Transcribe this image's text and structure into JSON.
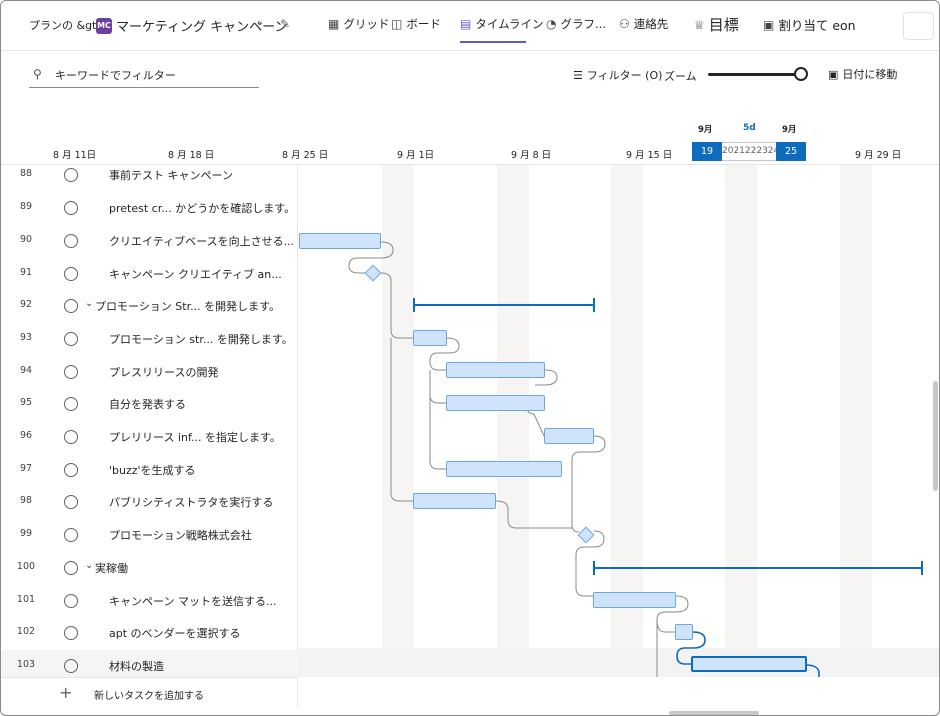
{
  "header": {
    "breadcrumb": "プランの &gt;",
    "plan_badge": "MC",
    "plan_name": "マーケティング キャンペーン",
    "tabs": [
      {
        "label": "グリッド",
        "icon": "grid-icon"
      },
      {
        "label": "ボード",
        "icon": "board-icon"
      },
      {
        "label": "タイムライン",
        "icon": "timeline-icon",
        "active": true
      },
      {
        "label": "グラフ...",
        "icon": "chart-icon"
      },
      {
        "label": "連絡先",
        "icon": "people-icon"
      },
      {
        "label": "目標",
        "icon": "trophy-icon"
      },
      {
        "label": "割り当て eon",
        "icon": "assign-icon"
      }
    ]
  },
  "toolbar": {
    "search_value": "キーワードでフィルター",
    "filter_label": "フィルター (O)",
    "zoom_label": "ズーム",
    "goto_label": "日付に移動"
  },
  "timeline": {
    "dates": [
      "8 月 11日",
      "8 月 18 日",
      "8 月 25 日",
      "9 月 1日",
      "9 月 8 日",
      "9 月 15 日",
      "9 月 29 日"
    ],
    "selection": {
      "month_start": "9月",
      "month_end": "9月",
      "duration": "5d",
      "start_day": "19",
      "middle": "2021222324",
      "end_day": "25"
    }
  },
  "tasks": [
    {
      "num": "88",
      "name": "事前テスト キャンペーン"
    },
    {
      "num": "89",
      "name": "pretest cr... かどうかを確認します。"
    },
    {
      "num": "90",
      "name": "クリエイティブベースを向上させる..."
    },
    {
      "num": "91",
      "name": "キャンペーン クリエイティブ an..."
    },
    {
      "num": "92",
      "name": "プロモーション Str... を開発します。",
      "summary": true
    },
    {
      "num": "93",
      "name": "プロモーション str... を開発します。"
    },
    {
      "num": "94",
      "name": "プレスリリースの開発"
    },
    {
      "num": "95",
      "name": "自分を発表する"
    },
    {
      "num": "96",
      "name": "プレリリース inf... を指定します。"
    },
    {
      "num": "97",
      "name": "'buzz'を生成する"
    },
    {
      "num": "98",
      "name": "パブリシティストラタを実行する"
    },
    {
      "num": "99",
      "name": "プロモーション戦略株式会社"
    },
    {
      "num": "100",
      "name": "実稼働",
      "summary": true
    },
    {
      "num": "101",
      "name": "キャンペーン マットを送信する..."
    },
    {
      "num": "102",
      "name": "apt のベンダーを選択する"
    },
    {
      "num": "103",
      "name": "材料の製造"
    }
  ],
  "footer": {
    "add_task": "新しいタスクを追加する"
  }
}
